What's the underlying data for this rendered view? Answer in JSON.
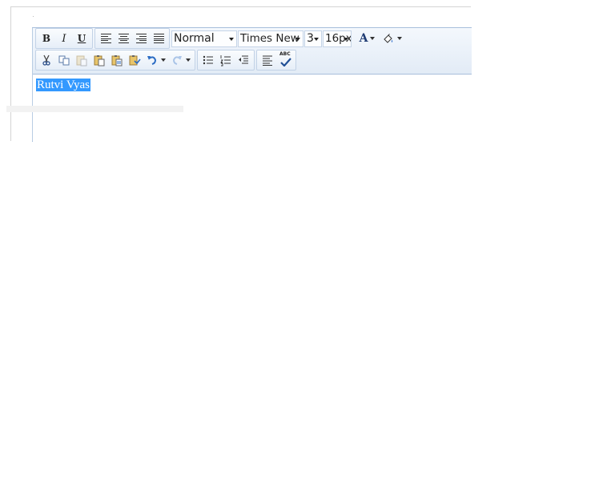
{
  "toolbar": {
    "bold_label": "B",
    "italic_label": "I",
    "underline_label": "U",
    "format_select": "Normal",
    "font_select": "Times New ..",
    "size_select": "3",
    "px_select": "16px",
    "font_color_label": "A",
    "spellcheck_label": "ABC",
    "icons": {
      "bold": "bold-icon",
      "italic": "italic-icon",
      "underline": "underline-icon",
      "align_left": "align-left-icon",
      "align_center": "align-center-icon",
      "align_right": "align-right-icon",
      "justify": "justify-icon",
      "font_color": "font-color-icon",
      "highlight": "highlight-color-icon",
      "cut": "cut-icon",
      "copy": "copy-icon",
      "paste": "paste-icon",
      "paste_text": "paste-text-icon",
      "paste_word": "paste-word-icon",
      "paste_special": "paste-special-icon",
      "undo": "undo-icon",
      "redo": "redo-icon",
      "bullet_list": "bulleted-list-icon",
      "numbered_list": "numbered-list-icon",
      "outdent": "outdent-icon",
      "paragraph": "paragraph-icon",
      "spellcheck": "spellcheck-icon"
    }
  },
  "editor": {
    "content_text": "Rutvi Vyas"
  },
  "colors": {
    "selection": "#3399ff",
    "toolbar_border": "#a8bfdc",
    "undo_blue": "#2b6cc4"
  }
}
